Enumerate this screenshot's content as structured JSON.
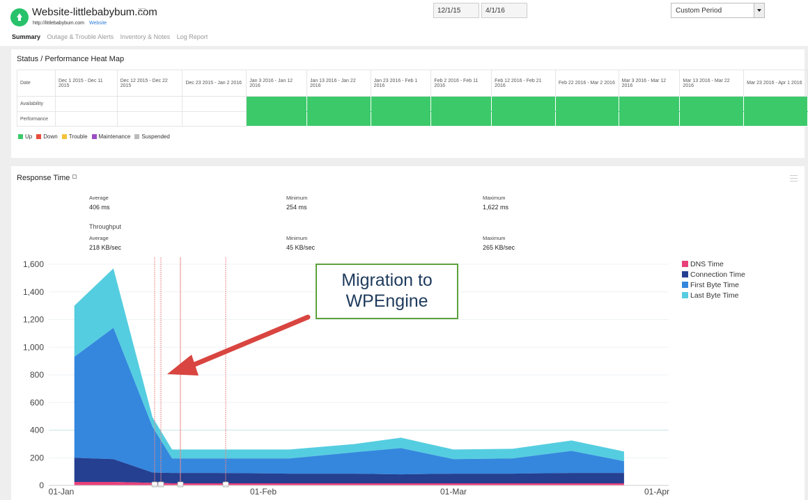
{
  "header": {
    "title": "Website-littlebabybum.com",
    "url": "http://littlebabybum.com",
    "type": "Website",
    "tabs": [
      "Summary",
      "Outage & Trouble Alerts",
      "Inventory & Notes",
      "Log Report"
    ],
    "date_from": "12/1/15",
    "date_to": "4/1/16",
    "period": "Custom Period"
  },
  "heatmap": {
    "title": "Status / Performance Heat Map",
    "date_label": "Date",
    "row_labels": [
      "Availability",
      "Performance"
    ],
    "columns": [
      {
        "label": "Dec 1 2015 - Dec 11 2015",
        "status": "none"
      },
      {
        "label": "Dec 12 2015 - Dec 22 2015",
        "status": "none"
      },
      {
        "label": "Dec 23 2015 - Jan 2 2016",
        "status": "none"
      },
      {
        "label": "Jan 3 2016 - Jan 12 2016",
        "status": "up"
      },
      {
        "label": "Jan 13 2016 - Jan 22 2016",
        "status": "up"
      },
      {
        "label": "Jan 23 2016 - Feb 1 2016",
        "status": "up"
      },
      {
        "label": "Feb 2 2016 - Feb 11 2016",
        "status": "up"
      },
      {
        "label": "Feb 12 2016 - Feb 21 2016",
        "status": "up"
      },
      {
        "label": "Feb 22 2016 - Mar 2 2016",
        "status": "up"
      },
      {
        "label": "Mar 3 2016 - Mar 12 2016",
        "status": "up"
      },
      {
        "label": "Mar 13 2016 - Mar 22 2016",
        "status": "up"
      },
      {
        "label": "Mar 23 2016 - Apr 1 2016",
        "status": "up"
      }
    ],
    "legend": [
      {
        "label": "Up",
        "color": "#3cc96a"
      },
      {
        "label": "Down",
        "color": "#e84c3d"
      },
      {
        "label": "Trouble",
        "color": "#f5c23a"
      },
      {
        "label": "Maintenance",
        "color": "#9b4fc4"
      },
      {
        "label": "Suspended",
        "color": "#bbbbbb"
      }
    ]
  },
  "response": {
    "title": "Response Time",
    "average_label": "Average",
    "average": "406 ms",
    "minimum_label": "Minimum",
    "minimum": "254 ms",
    "maximum_label": "Maximum",
    "maximum": "1,622 ms",
    "throughput_label": "Throughput",
    "tp_average_label": "Average",
    "tp_average": "218 KB/sec",
    "tp_minimum_label": "Minimum",
    "tp_minimum": "45 KB/sec",
    "tp_maximum_label": "Maximum",
    "tp_maximum": "265 KB/sec"
  },
  "callout": {
    "line1": "Migration to",
    "line2": "WPEngine"
  },
  "chart_data": {
    "type": "area",
    "stacked": true,
    "ylim": [
      0,
      1600
    ],
    "yticks": [
      "0",
      "200",
      "400",
      "600",
      "800",
      "1,000",
      "1,200",
      "1,400",
      "1,600"
    ],
    "xticks": [
      "01-Jan",
      "01-Feb",
      "01-Mar",
      "01-Apr"
    ],
    "x": [
      "2016-01-03",
      "2016-01-09",
      "2016-01-15",
      "2016-01-18",
      "2016-01-25",
      "2016-02-05",
      "2016-02-15",
      "2016-02-22",
      "2016-03-01",
      "2016-03-10",
      "2016-03-19",
      "2016-03-27"
    ],
    "series": [
      {
        "name": "DNS Time",
        "color": "#e8407a",
        "values": [
          25,
          25,
          18,
          15,
          15,
          15,
          15,
          15,
          15,
          15,
          15,
          15
        ]
      },
      {
        "name": "Connection Time",
        "color": "#253f91",
        "values": [
          175,
          165,
          75,
          75,
          75,
          70,
          70,
          65,
          70,
          70,
          75,
          75
        ]
      },
      {
        "name": "First Byte Time",
        "color": "#3487dd",
        "values": [
          730,
          950,
          330,
          105,
          105,
          110,
          155,
          190,
          105,
          110,
          160,
          85
        ]
      },
      {
        "name": "Last Byte Time",
        "color": "#55cde0",
        "values": [
          370,
          430,
          70,
          65,
          65,
          65,
          60,
          75,
          70,
          70,
          75,
          70
        ]
      }
    ],
    "grid": true,
    "legend": "right"
  }
}
